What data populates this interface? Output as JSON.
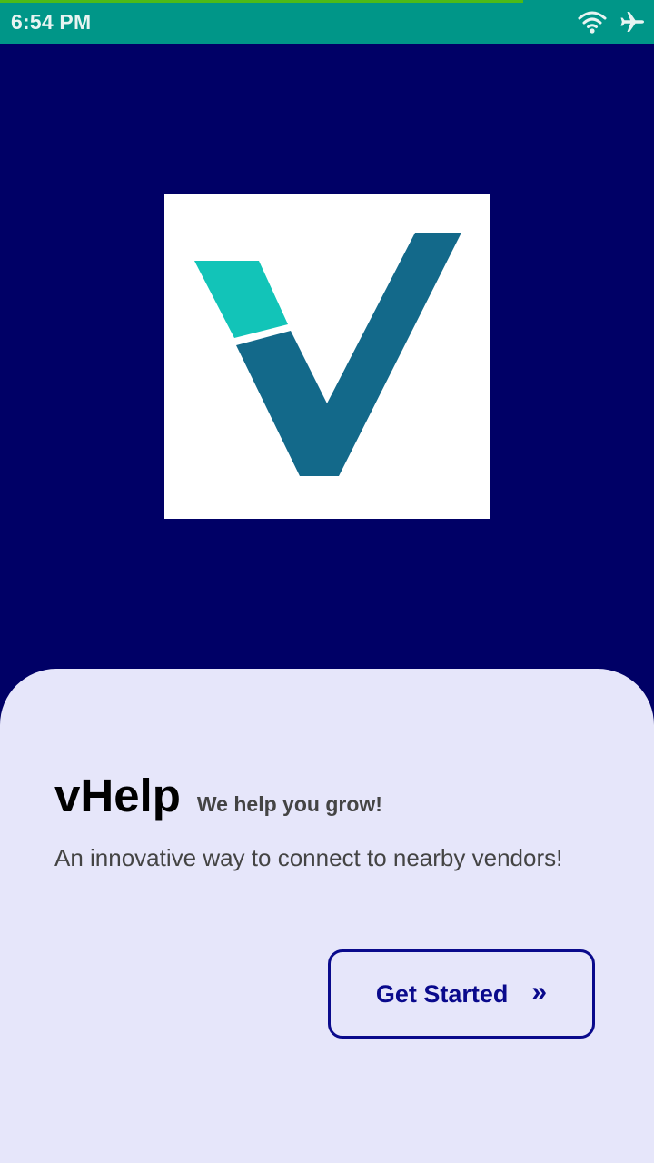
{
  "status_bar": {
    "time": "6:54 PM",
    "icons": [
      "wifi-icon",
      "airplane-mode-icon"
    ],
    "color": "#009688",
    "progress_color": "#4CBB17",
    "progress": 0.8
  },
  "splash": {
    "background_color": "#000066",
    "logo": "vhelp-logo",
    "logo_colors": [
      "#12C4B8",
      "#13698A"
    ]
  },
  "sheet": {
    "background_color": "#E6E6FA",
    "title": "vHelp",
    "tagline": "We help you grow!",
    "description": "An innovative way to connect to nearby vendors!",
    "cta": {
      "label": "Get Started",
      "arrow": "»",
      "color": "#0A0A8C"
    }
  }
}
